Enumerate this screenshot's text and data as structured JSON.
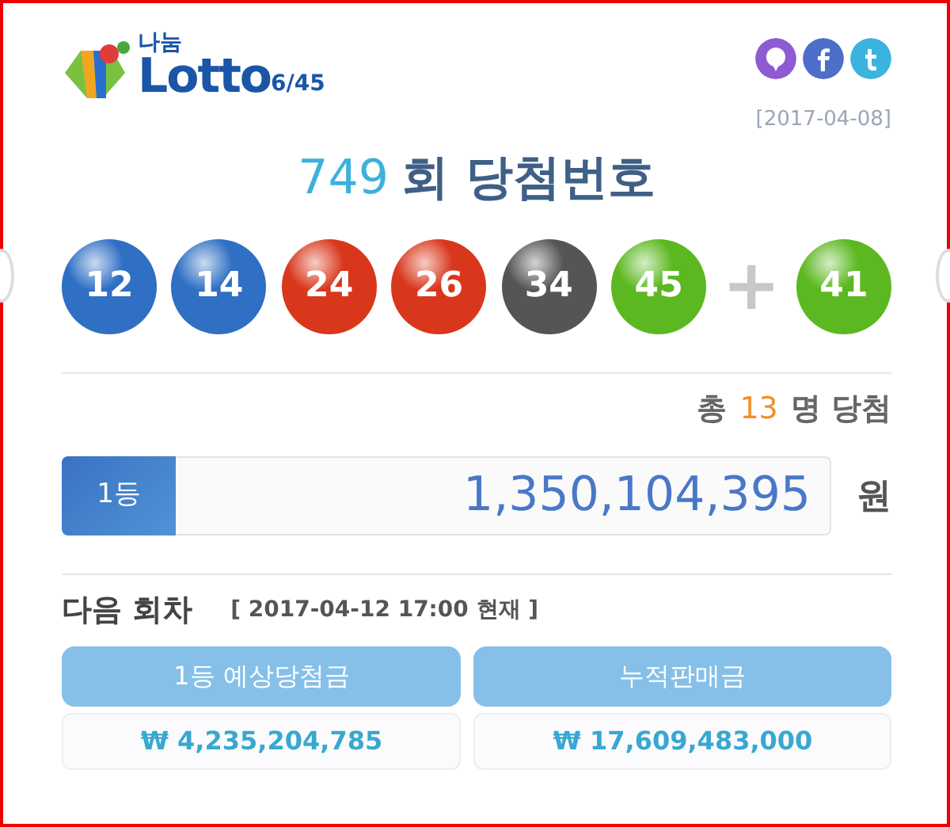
{
  "logo": {
    "top": "나눔",
    "brand": "Lotto",
    "suffix": "6/45"
  },
  "share": [
    {
      "kind": "kakao"
    },
    {
      "kind": "facebook"
    },
    {
      "kind": "twitter"
    }
  ],
  "draw_date": "[2017-04-08]",
  "title": {
    "round": "749",
    "text": "회 당첨번호"
  },
  "balls": [
    {
      "number": "12",
      "color": "#2f6fc4"
    },
    {
      "number": "14",
      "color": "#2f6fc4"
    },
    {
      "number": "24",
      "color": "#d9371c"
    },
    {
      "number": "26",
      "color": "#d9371c"
    },
    {
      "number": "34",
      "color": "#555555"
    },
    {
      "number": "45",
      "color": "#5cb820"
    }
  ],
  "plus": "+",
  "bonus": {
    "number": "41",
    "color": "#5cb820"
  },
  "winners": {
    "prefix": "총",
    "count": "13",
    "suffix": "명 당첨"
  },
  "prize": {
    "rank": "1등",
    "amount": "1,350,104,395",
    "unit": "원"
  },
  "next": {
    "label": "다음 회차",
    "asof": "[ 2017-04-12 17:00 현재 ]"
  },
  "stats": [
    {
      "label": "1등 예상당첨금",
      "value": "₩ 4,235,204,785"
    },
    {
      "label": "누적판매금",
      "value": "₩ 17,609,483,000"
    }
  ]
}
